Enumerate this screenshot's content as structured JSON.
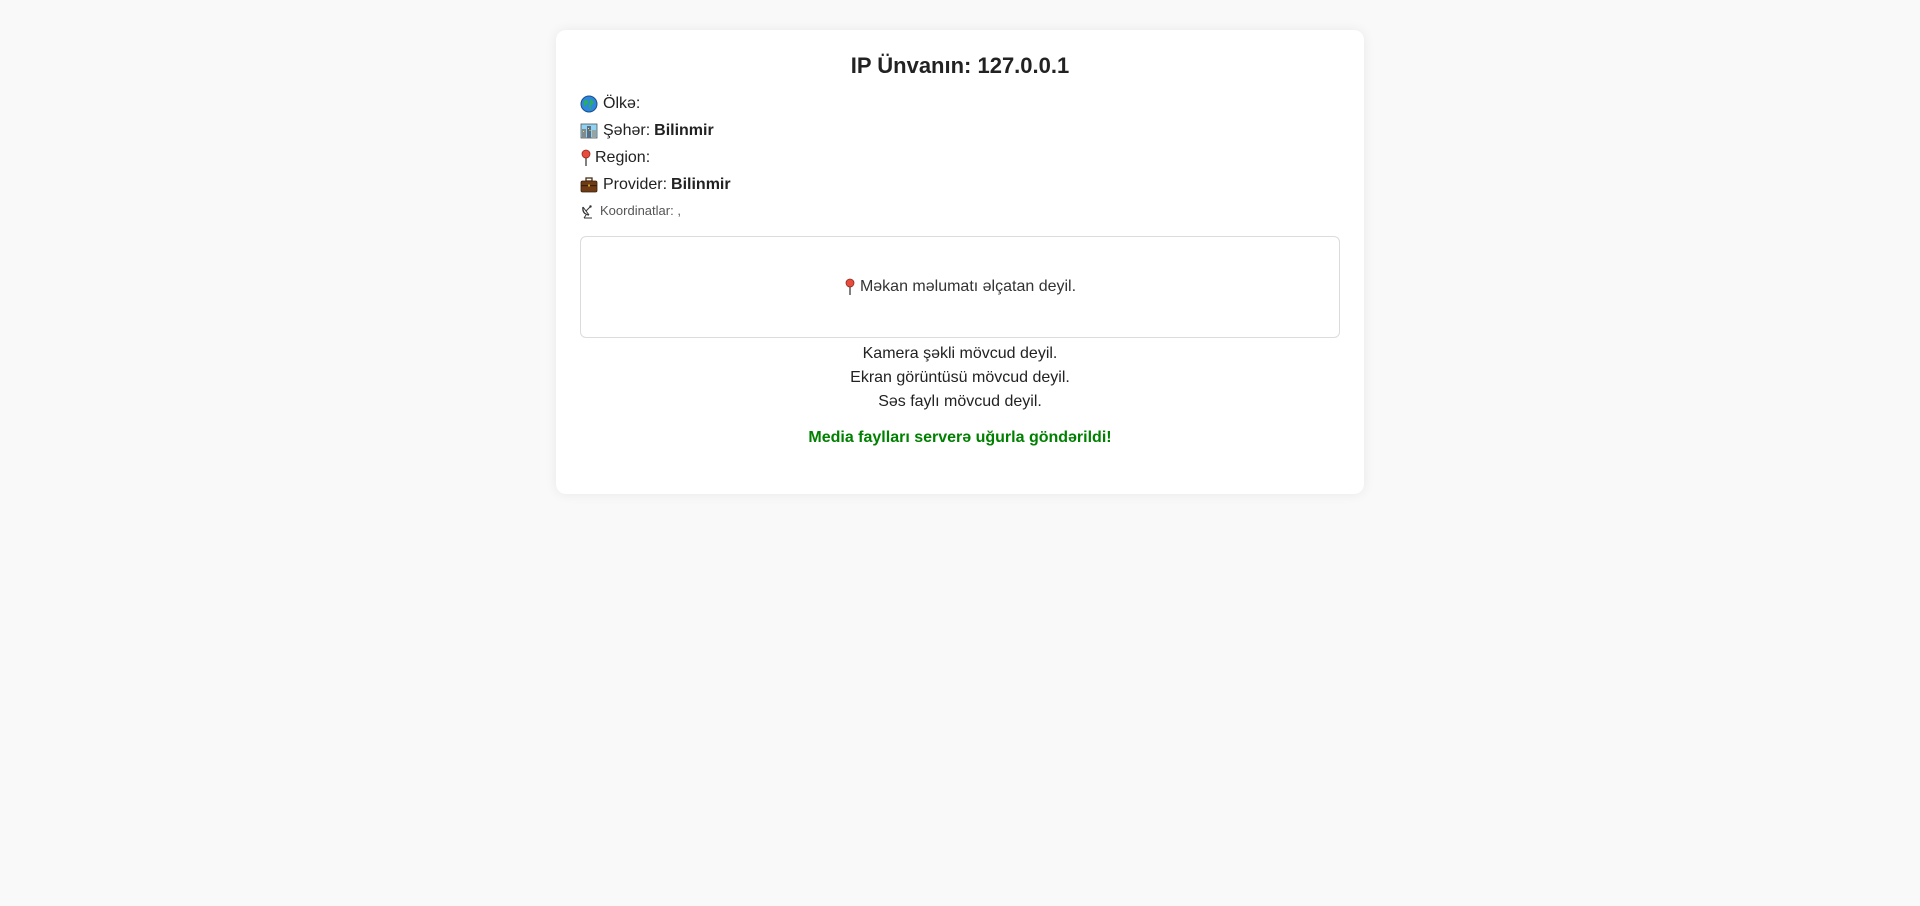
{
  "header": {
    "title": "IP Ünvanın: 127.0.0.1"
  },
  "info": {
    "country": {
      "icon": "globe-icon",
      "label": "Ölkə:",
      "value": ""
    },
    "city": {
      "icon": "cityscape-icon",
      "label": "Şəhər:",
      "value": "Bilinmir"
    },
    "region": {
      "icon": "round-pushpin-icon",
      "label": "Region:",
      "value": ""
    },
    "provider": {
      "icon": "briefcase-icon",
      "label": "Provider:",
      "value": "Bilinmir"
    },
    "coordinates": {
      "icon": "satellite-dish-icon",
      "label": "Koordinatlar: ,"
    }
  },
  "map": {
    "icon": "round-pushpin-icon",
    "message": "Məkan məlumatı əlçatan deyil."
  },
  "media": {
    "camera": "Kamera şəkli mövcud deyil.",
    "screenshot": "Ekran görüntüsü mövcud deyil.",
    "audio": "Səs faylı mövcud deyil."
  },
  "status": {
    "message": "Media faylları serverə uğurla göndərildi!",
    "color": "#008000"
  }
}
